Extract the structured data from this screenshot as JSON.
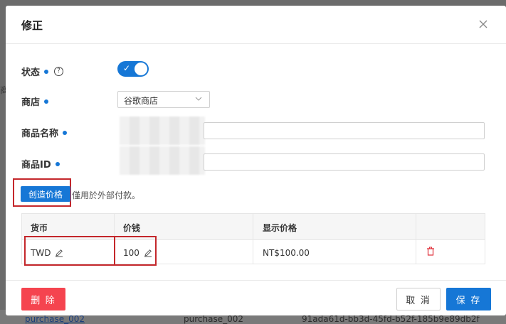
{
  "background": {
    "row_link": "purchase_002",
    "row_col2": "purchase_002",
    "row_col3": "91ada61d-bb3d-45fd-b52f-185b9e89db2f",
    "edge_glyph": "商"
  },
  "dialog": {
    "title": "修正",
    "close_icon": "close-icon"
  },
  "form": {
    "status": {
      "label": "状态",
      "help_icon": "question-circle-icon",
      "toggle_on": true,
      "check_glyph": "✓"
    },
    "store": {
      "label": "商店",
      "selected": "谷歌商店",
      "caret_icon": "chevron-down-icon"
    },
    "product_name": {
      "label": "商品名称",
      "value": ""
    },
    "product_id": {
      "label": "商品ID",
      "value": ""
    }
  },
  "create_price": {
    "button_label": "创造价格",
    "hint": "僅用於外部付款。"
  },
  "price_table": {
    "headers": [
      "货币",
      "价钱",
      "显示价格",
      ""
    ],
    "rows": [
      {
        "currency": "TWD",
        "price": "100",
        "display_price": "NT$100.00"
      }
    ]
  },
  "footer": {
    "delete_label": "删 除",
    "cancel_label": "取 消",
    "save_label": "保 存"
  },
  "colors": {
    "primary": "#1677d6",
    "danger": "#f5444f",
    "highlight": "#c4272b"
  }
}
